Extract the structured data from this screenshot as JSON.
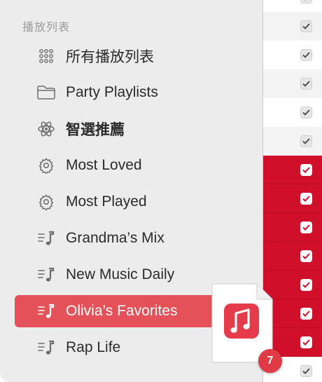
{
  "sidebar": {
    "section_title": "播放列表",
    "items": [
      {
        "label": "所有播放列表",
        "icon": "grid-icon"
      },
      {
        "label": "Party Playlists",
        "icon": "folder-icon"
      },
      {
        "label": "智選推薦",
        "icon": "atom-icon"
      },
      {
        "label": "Most Loved",
        "icon": "gear-icon"
      },
      {
        "label": "Most Played",
        "icon": "gear-icon"
      },
      {
        "label": "Grandma’s Mix",
        "icon": "playlist-icon"
      },
      {
        "label": "New Music Daily",
        "icon": "playlist-icon"
      },
      {
        "label": "Olivia’s Favorites",
        "icon": "playlist-icon",
        "selected": true
      },
      {
        "label": "Rap Life",
        "icon": "playlist-icon"
      }
    ]
  },
  "drag": {
    "badge_count": "7",
    "icon": "music-note-icon"
  },
  "track_list": {
    "checked_rows": 13,
    "highlighted_rows": 7
  },
  "colors": {
    "selection": "#e55159",
    "row_highlight": "#d0102a",
    "badge": "#e03a46"
  }
}
